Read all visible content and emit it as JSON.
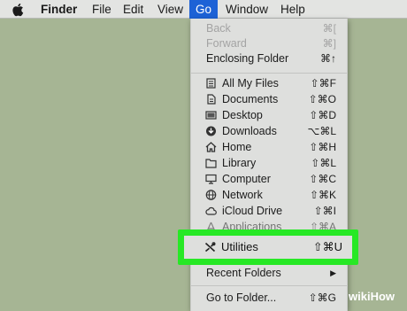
{
  "menubar": {
    "apple_icon": "apple-logo-icon",
    "items": [
      "Finder",
      "File",
      "Edit",
      "View",
      "Go",
      "Window",
      "Help"
    ],
    "active": "Go",
    "active_color": "#1d62d6"
  },
  "go_menu": {
    "back": {
      "label": "Back",
      "shortcut": "⌘[",
      "enabled": false
    },
    "forward": {
      "label": "Forward",
      "shortcut": "⌘]",
      "enabled": false
    },
    "enclosing": {
      "label": "Enclosing Folder",
      "shortcut": "⌘↑"
    },
    "all_my_files": {
      "label": "All My Files",
      "shortcut": "⇧⌘F",
      "icon": "all-files-icon"
    },
    "documents": {
      "label": "Documents",
      "shortcut": "⇧⌘O",
      "icon": "documents-icon"
    },
    "desktop": {
      "label": "Desktop",
      "shortcut": "⇧⌘D",
      "icon": "desktop-icon"
    },
    "downloads": {
      "label": "Downloads",
      "shortcut": "⌥⌘L",
      "icon": "downloads-icon"
    },
    "home": {
      "label": "Home",
      "shortcut": "⇧⌘H",
      "icon": "home-icon"
    },
    "library": {
      "label": "Library",
      "shortcut": "⇧⌘L",
      "icon": "library-icon"
    },
    "computer": {
      "label": "Computer",
      "shortcut": "⇧⌘C",
      "icon": "computer-icon"
    },
    "network": {
      "label": "Network",
      "shortcut": "⇧⌘K",
      "icon": "network-icon"
    },
    "icloud": {
      "label": "iCloud Drive",
      "shortcut": "⇧⌘I",
      "icon": "icloud-icon"
    },
    "applications": {
      "label": "Applications",
      "shortcut": "⇧⌘A",
      "icon": "applications-icon"
    },
    "utilities": {
      "label": "Utilities",
      "shortcut": "⇧⌘U",
      "icon": "utilities-icon",
      "highlighted": true,
      "highlight_color": "#27e825"
    },
    "recent": {
      "label": "Recent Folders",
      "submenu_arrow": "▶"
    },
    "goto": {
      "label": "Go to Folder...",
      "shortcut": "⇧⌘G"
    }
  },
  "watermark": {
    "w": "w",
    "iki": "iki",
    "how": "How"
  }
}
